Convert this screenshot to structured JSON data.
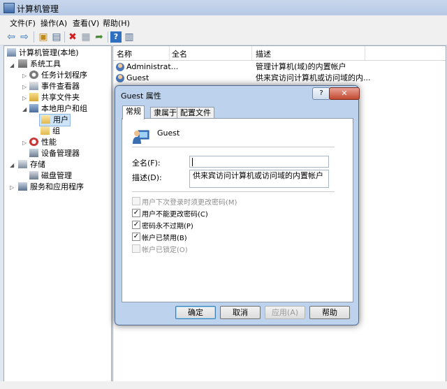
{
  "window": {
    "title": "计算机管理",
    "menu": [
      "文件(F)",
      "操作(A)",
      "查看(V)",
      "帮助(H)"
    ]
  },
  "tree": {
    "root": "计算机管理(本地)",
    "system_tools": "系统工具",
    "task_scheduler": "任务计划程序",
    "event_viewer": "事件查看器",
    "shared_folders": "共享文件夹",
    "local_users_groups": "本地用户和组",
    "users": "用户",
    "groups": "组",
    "performance": "性能",
    "device_manager": "设备管理器",
    "storage": "存储",
    "disk_management": "磁盘管理",
    "services_apps": "服务和应用程序"
  },
  "list": {
    "headers": {
      "name": "名称",
      "fullname": "全名",
      "description": "描述"
    },
    "rows": [
      {
        "name": "Administrat...",
        "fullname": "",
        "description": "管理计算机(域)的内置帐户"
      },
      {
        "name": "Guest",
        "fullname": "",
        "description": "供来宾访问计算机或访问域的内..."
      }
    ]
  },
  "dialog": {
    "title": "Guest 属性",
    "help_glyph": "?",
    "close_glyph": "✕",
    "tabs": [
      "常规",
      "隶属于",
      "配置文件"
    ],
    "username": "Guest",
    "fullname_label": "全名(F):",
    "fullname_value": "",
    "description_label": "描述(D):",
    "description_value": "供来宾访问计算机或访问域的内置帐户",
    "checkboxes": [
      {
        "label": "用户下次登录时须更改密码(M)",
        "checked": false,
        "disabled": true
      },
      {
        "label": "用户不能更改密码(C)",
        "checked": true,
        "disabled": false
      },
      {
        "label": "密码永不过期(P)",
        "checked": true,
        "disabled": false
      },
      {
        "label": "帐户已禁用(B)",
        "checked": true,
        "disabled": false
      },
      {
        "label": "帐户已锁定(O)",
        "checked": false,
        "disabled": true
      }
    ],
    "buttons": {
      "ok": "确定",
      "cancel": "取消",
      "apply": "应用(A)",
      "help": "帮助"
    }
  }
}
